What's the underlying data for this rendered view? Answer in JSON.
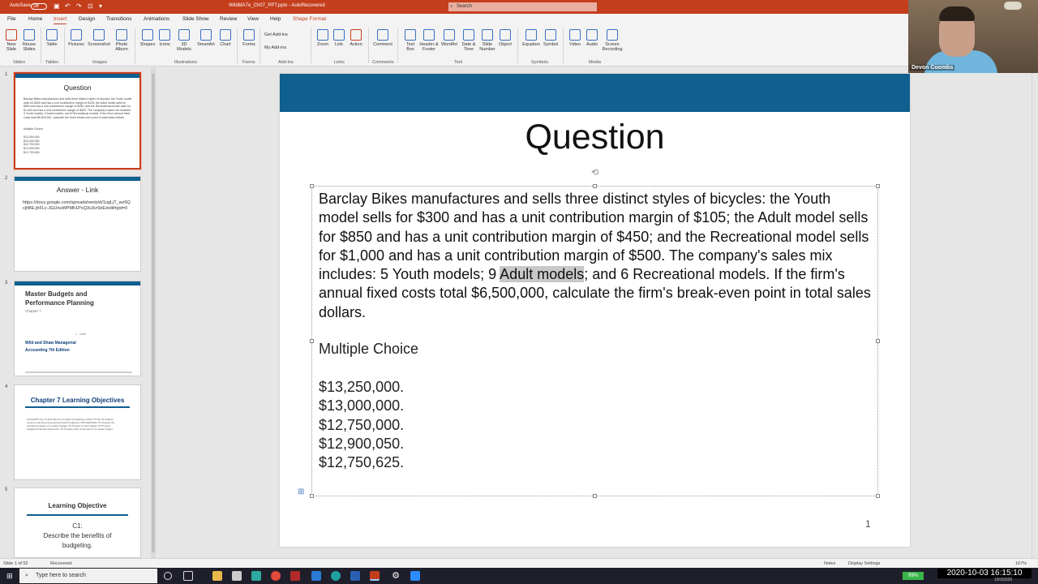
{
  "titlebar": {
    "autosave": "AutoSave",
    "autosave_state": "Off",
    "filename": "WildMA7e_Ch07_PPT.pptx - AutoRecovered",
    "search_placeholder": "Search"
  },
  "tabs": [
    "File",
    "Home",
    "Insert",
    "Design",
    "Transitions",
    "Animations",
    "Slide Show",
    "Review",
    "View",
    "Help",
    "Shape Format"
  ],
  "active_tab": "Insert",
  "ribbon": {
    "buttons": [
      "New Slide",
      "Reuse Slides",
      "Table",
      "Pictures",
      "Screenshot",
      "Photo Album",
      "Shapes",
      "Icons",
      "3D Models",
      "SmartArt",
      "Chart",
      "Forms",
      "Get Add-ins",
      "My Add-ins",
      "Zoom",
      "Link",
      "Action",
      "Comment",
      "Text Box",
      "Header & Footer",
      "WordArt",
      "Date & Time",
      "Slide Number",
      "Object",
      "Equation",
      "Symbol",
      "Video",
      "Audio",
      "Screen Recording"
    ],
    "groups": [
      "Slides",
      "Tables",
      "Images",
      "Illustrations",
      "Forms",
      "Add-ins",
      "Links",
      "Comments",
      "Text",
      "Symbols",
      "Media"
    ]
  },
  "webcam": {
    "name": "Devon Coombs"
  },
  "thumbnails": {
    "s1": {
      "num": "1",
      "title": "Question",
      "body": "Barclay Bikes manufactures and sells three distinct styles of bicycles: the Youth model sells for $300 and has a unit contribution margin of $105; the Adult model sells for $850 and has a unit contribution margin of $450; and the Recreational model sells for $1,000 and has a unit contribution margin of $500. The company's sales mix includes: 5 Youth models; 9 Adult models; and 6 Recreational models. If the firm's annual fixed costs total $6,500,000, calculate the firm's break-even point in total sales dollars.",
      "mc": "Multiple Choice",
      "choices": "$13,250,000. $13,000,000. $12,750,000. $12,900,050. $12,750,625."
    },
    "s2": {
      "num": "2",
      "title": "Answer - Link",
      "body": "https://docs.google.com/spreadsheets/d/1ugLjT_wx5QcjhBE-jhFLc-JGUnuWPMh1PxQ3u3vr9zE/edit#gid=0"
    },
    "s3": {
      "num": "3",
      "title": "Master Budgets and Performance Planning",
      "sub": "Chapter 7",
      "mark": "1 - 1843",
      "book": "Wild and Shaw Managerial Accounting 7th Edition"
    },
    "s4": {
      "num": "4",
      "title": "Chapter 7 Learning Objectives",
      "lines": "CONCEPTUAL C1 Describe the benefits of budgeting. ANALYTICAL A1 Analyze expense planning using activity-based budgeting. PROCEDURAL P1 Prepare the operating budgets of a master budget. P2 Prepare a cash budget. P3 Prepare budgeted financial statements. P4 Prepare each component of a master budget."
    },
    "s5": {
      "num": "5",
      "title": "Learning Objective",
      "c": "C1:",
      "desc": "Describe the benefits of budgeting."
    }
  },
  "slide": {
    "title": "Question",
    "body_pre": "Barclay Bikes manufactures and sells three distinct styles of bicycles: the Youth model sells for $300 and has a unit contribution margin of $105; the Adult model sells for $850 and has a unit contribution margin of $450; and the Recreational model sells for $1,000 and has a unit contribution margin of $500. The company's sales mix includes: 5 Youth models; 9 ",
    "body_highlight": "Adult models",
    "body_post": "; and 6 Recreational models. If the firm's annual fixed costs total $6,500,000, calculate the firm's break-even point in total sales dollars.",
    "mc_heading": "Multiple Choice",
    "choices": [
      "$13,250,000.",
      "$13,000,000.",
      "$12,750,000.",
      "$12,900,050.",
      "$12,750,625."
    ],
    "page_number": "1"
  },
  "status": {
    "slide_of": "Slide 1 of 52",
    "recovered": "Recovered",
    "notes": "Notes",
    "display": "Display Settings",
    "zoom": "167%"
  },
  "taskbar": {
    "search_placeholder": "Type here to search",
    "battery": "99%",
    "clock": "2020-10-03  16:15:10",
    "date": "10/3/2020"
  },
  "colors": {
    "accent": "#c43e1c",
    "slide_bar": "#0f5f8f"
  }
}
